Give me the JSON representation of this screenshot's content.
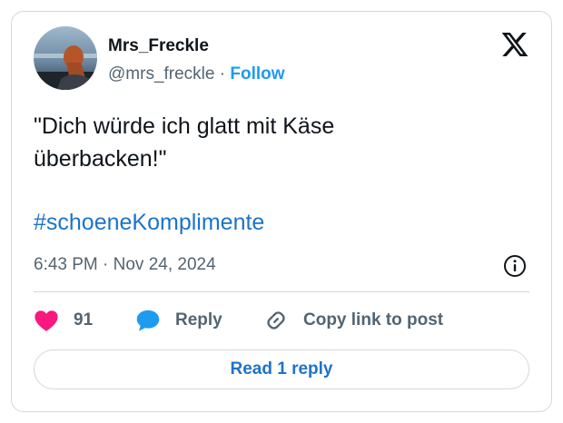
{
  "author": {
    "display_name": "Mrs_Freckle",
    "handle": "@mrs_freckle",
    "separator": "·",
    "follow_label": "Follow"
  },
  "tweet": {
    "text": "\"Dich würde ich glatt mit Käse\nüberbacken!\"",
    "hashtag": "#schoeneKomplimente",
    "timestamp": "6:43 PM · Nov 24, 2024"
  },
  "actions": {
    "like_count": "91",
    "reply_label": "Reply",
    "copy_link_label": "Copy link to post"
  },
  "read_replies_label": "Read 1 reply",
  "icons": {
    "platform": "x-logo-icon",
    "info": "info-icon",
    "like": "heart-icon",
    "reply": "speech-bubble-icon",
    "copy": "link-icon"
  },
  "colors": {
    "accent": "#1d9bf0",
    "link": "#1d73c9",
    "heart": "#f91880",
    "secondary_text": "#536471",
    "border": "#cfd9de"
  }
}
